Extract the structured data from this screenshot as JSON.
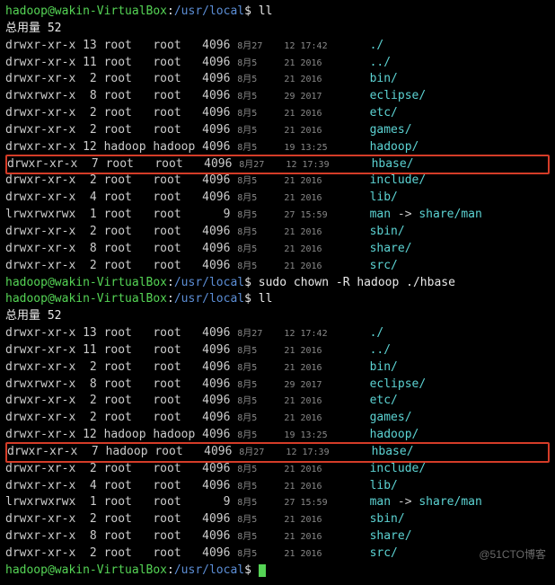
{
  "prompt": {
    "user": "hadoop",
    "host": "wakin-VirtualBox",
    "cwd": "/usr/local",
    "sep": "$"
  },
  "cmd1": "ll",
  "cmd2": "sudo chown -R hadoop ./hbase",
  "cmd3": "ll",
  "totalLabel": "总用量 52",
  "ls1": [
    {
      "perm": "drwxr-xr-x",
      "n": "13",
      "own": "root",
      "grp": "root",
      "sz": "4096",
      "d1": "8月27",
      "d2": "12 17:42",
      "name": "./",
      "cls": "cyan"
    },
    {
      "perm": "drwxr-xr-x",
      "n": "11",
      "own": "root",
      "grp": "root",
      "sz": "4096",
      "d1": "8月5",
      "d2": "21 2016",
      "name": "../",
      "cls": "cyan"
    },
    {
      "perm": "drwxr-xr-x",
      "n": "2",
      "own": "root",
      "grp": "root",
      "sz": "4096",
      "d1": "8月5",
      "d2": "21 2016",
      "name": "bin/",
      "cls": "cyan"
    },
    {
      "perm": "drwxrwxr-x",
      "n": "8",
      "own": "root",
      "grp": "root",
      "sz": "4096",
      "d1": "8月5",
      "d2": "29 2017",
      "name": "eclipse/",
      "cls": "cyan"
    },
    {
      "perm": "drwxr-xr-x",
      "n": "2",
      "own": "root",
      "grp": "root",
      "sz": "4096",
      "d1": "8月5",
      "d2": "21 2016",
      "name": "etc/",
      "cls": "cyan"
    },
    {
      "perm": "drwxr-xr-x",
      "n": "2",
      "own": "root",
      "grp": "root",
      "sz": "4096",
      "d1": "8月5",
      "d2": "21 2016",
      "name": "games/",
      "cls": "cyan"
    },
    {
      "perm": "drwxr-xr-x",
      "n": "12",
      "own": "hadoop",
      "grp": "hadoop",
      "sz": "4096",
      "d1": "8月5",
      "d2": "19 13:25",
      "name": "hadoop/",
      "cls": "cyan"
    },
    {
      "perm": "drwxr-xr-x",
      "n": "7",
      "own": "root",
      "grp": "root",
      "sz": "4096",
      "d1": "8月27",
      "d2": "12 17:39",
      "name": "hbase/",
      "cls": "cyan",
      "hl": true
    },
    {
      "perm": "drwxr-xr-x",
      "n": "2",
      "own": "root",
      "grp": "root",
      "sz": "4096",
      "d1": "8月5",
      "d2": "21 2016",
      "name": "include/",
      "cls": "cyan"
    },
    {
      "perm": "drwxr-xr-x",
      "n": "4",
      "own": "root",
      "grp": "root",
      "sz": "4096",
      "d1": "8月5",
      "d2": "21 2016",
      "name": "lib/",
      "cls": "cyan"
    },
    {
      "perm": "lrwxrwxrwx",
      "n": "1",
      "own": "root",
      "grp": "root",
      "sz": "9",
      "d1": "8月5",
      "d2": "27 15:59",
      "name": "man",
      "cls": "cyan",
      "link": " -> ",
      "target": "share/man",
      "tcls": "cyan"
    },
    {
      "perm": "drwxr-xr-x",
      "n": "2",
      "own": "root",
      "grp": "root",
      "sz": "4096",
      "d1": "8月5",
      "d2": "21 2016",
      "name": "sbin/",
      "cls": "cyan"
    },
    {
      "perm": "drwxr-xr-x",
      "n": "8",
      "own": "root",
      "grp": "root",
      "sz": "4096",
      "d1": "8月5",
      "d2": "21 2016",
      "name": "share/",
      "cls": "cyan"
    },
    {
      "perm": "drwxr-xr-x",
      "n": "2",
      "own": "root",
      "grp": "root",
      "sz": "4096",
      "d1": "8月5",
      "d2": "21 2016",
      "name": "src/",
      "cls": "cyan"
    }
  ],
  "ls2": [
    {
      "perm": "drwxr-xr-x",
      "n": "13",
      "own": "root",
      "grp": "root",
      "sz": "4096",
      "d1": "8月27",
      "d2": "12 17:42",
      "name": "./",
      "cls": "cyan"
    },
    {
      "perm": "drwxr-xr-x",
      "n": "11",
      "own": "root",
      "grp": "root",
      "sz": "4096",
      "d1": "8月5",
      "d2": "21 2016",
      "name": "../",
      "cls": "cyan"
    },
    {
      "perm": "drwxr-xr-x",
      "n": "2",
      "own": "root",
      "grp": "root",
      "sz": "4096",
      "d1": "8月5",
      "d2": "21 2016",
      "name": "bin/",
      "cls": "cyan"
    },
    {
      "perm": "drwxrwxr-x",
      "n": "8",
      "own": "root",
      "grp": "root",
      "sz": "4096",
      "d1": "8月5",
      "d2": "29 2017",
      "name": "eclipse/",
      "cls": "cyan"
    },
    {
      "perm": "drwxr-xr-x",
      "n": "2",
      "own": "root",
      "grp": "root",
      "sz": "4096",
      "d1": "8月5",
      "d2": "21 2016",
      "name": "etc/",
      "cls": "cyan"
    },
    {
      "perm": "drwxr-xr-x",
      "n": "2",
      "own": "root",
      "grp": "root",
      "sz": "4096",
      "d1": "8月5",
      "d2": "21 2016",
      "name": "games/",
      "cls": "cyan"
    },
    {
      "perm": "drwxr-xr-x",
      "n": "12",
      "own": "hadoop",
      "grp": "hadoop",
      "sz": "4096",
      "d1": "8月5",
      "d2": "19 13:25",
      "name": "hadoop/",
      "cls": "cyan"
    },
    {
      "perm": "drwxr-xr-x",
      "n": "7",
      "own": "hadoop",
      "grp": "root",
      "sz": "4096",
      "d1": "8月27",
      "d2": "12 17:39",
      "name": "hbase/",
      "cls": "cyan",
      "hl": true
    },
    {
      "perm": "drwxr-xr-x",
      "n": "2",
      "own": "root",
      "grp": "root",
      "sz": "4096",
      "d1": "8月5",
      "d2": "21 2016",
      "name": "include/",
      "cls": "cyan"
    },
    {
      "perm": "drwxr-xr-x",
      "n": "4",
      "own": "root",
      "grp": "root",
      "sz": "4096",
      "d1": "8月5",
      "d2": "21 2016",
      "name": "lib/",
      "cls": "cyan"
    },
    {
      "perm": "lrwxrwxrwx",
      "n": "1",
      "own": "root",
      "grp": "root",
      "sz": "9",
      "d1": "8月5",
      "d2": "27 15:59",
      "name": "man",
      "cls": "cyan",
      "link": " -> ",
      "target": "share/man",
      "tcls": "cyan"
    },
    {
      "perm": "drwxr-xr-x",
      "n": "2",
      "own": "root",
      "grp": "root",
      "sz": "4096",
      "d1": "8月5",
      "d2": "21 2016",
      "name": "sbin/",
      "cls": "cyan"
    },
    {
      "perm": "drwxr-xr-x",
      "n": "8",
      "own": "root",
      "grp": "root",
      "sz": "4096",
      "d1": "8月5",
      "d2": "21 2016",
      "name": "share/",
      "cls": "cyan"
    },
    {
      "perm": "drwxr-xr-x",
      "n": "2",
      "own": "root",
      "grp": "root",
      "sz": "4096",
      "d1": "8月5",
      "d2": "21 2016",
      "name": "src/",
      "cls": "cyan"
    }
  ],
  "watermark": "@51CTO博客"
}
